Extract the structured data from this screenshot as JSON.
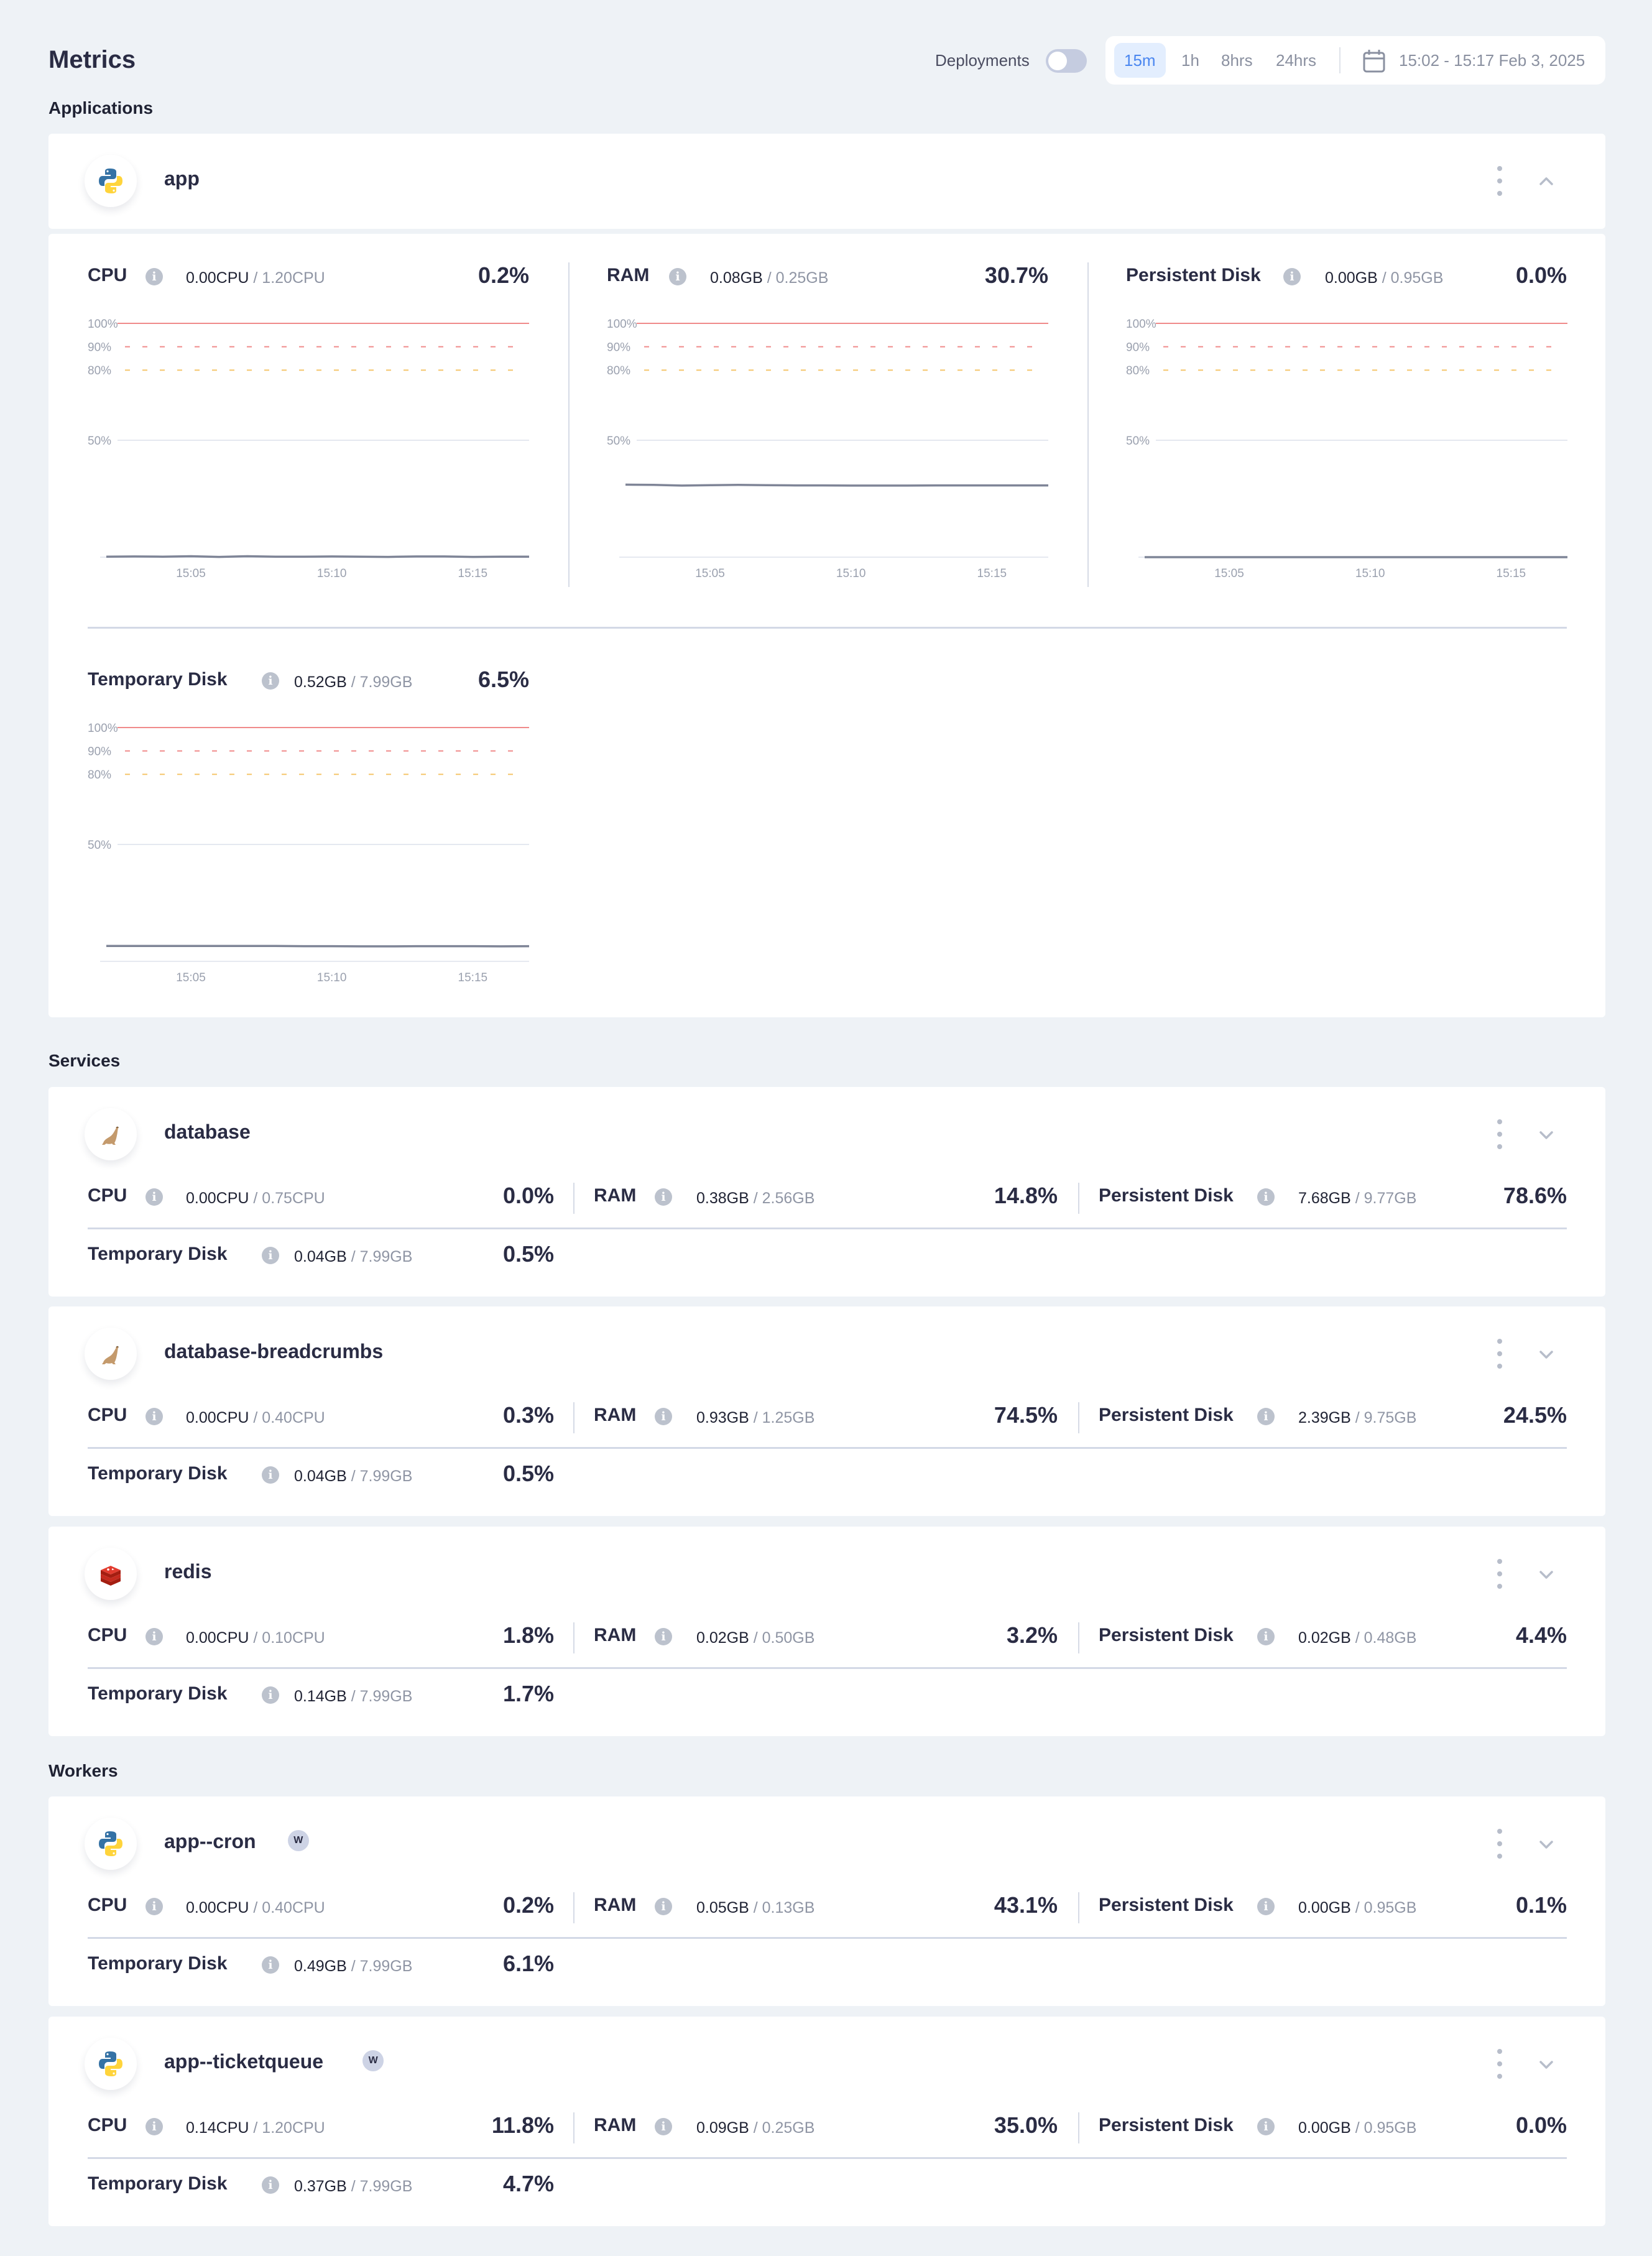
{
  "header": {
    "title": "Metrics",
    "deployments_label": "Deployments",
    "deployments_enabled": false,
    "ranges": [
      "15m",
      "1h",
      "8hrs",
      "24hrs"
    ],
    "active_range": "15m",
    "date_range": "15:02 - 15:17 Feb 3, 2025"
  },
  "sections": {
    "applications": "Applications",
    "services": "Services",
    "workers": "Workers"
  },
  "colors": {
    "critical": "#f08a8a",
    "warning": "#f5c56b",
    "series": "#7f8597",
    "accent": "#4a86f0"
  },
  "app": {
    "name": "app",
    "icon": "python-icon",
    "expanded": true,
    "charts": [
      {
        "label": "CPU",
        "used": "0.00CPU",
        "limit": "1.20CPU",
        "percent": "0.2%"
      },
      {
        "label": "RAM",
        "used": "0.08GB",
        "limit": "0.25GB",
        "percent": "30.7%"
      },
      {
        "label": "Persistent Disk",
        "used": "0.00GB",
        "limit": "0.95GB",
        "percent": "0.0%"
      },
      {
        "label": "Temporary Disk",
        "used": "0.52GB",
        "limit": "7.99GB",
        "percent": "6.5%"
      }
    ]
  },
  "chart_data": [
    {
      "type": "line",
      "title": "CPU",
      "x": [
        "15:02",
        "15:03",
        "15:04",
        "15:05",
        "15:06",
        "15:07",
        "15:08",
        "15:09",
        "15:10",
        "15:11",
        "15:12",
        "15:13",
        "15:14",
        "15:15",
        "15:16",
        "15:17"
      ],
      "xticks": [
        "15:05",
        "15:10",
        "15:15"
      ],
      "yticks": [
        "100%",
        "90%",
        "80%",
        "50%"
      ],
      "ylim": [
        0,
        100
      ],
      "thresholds": [
        {
          "value": 100,
          "style": "solid",
          "color": "critical"
        },
        {
          "value": 90,
          "style": "dashed",
          "color": "critical"
        },
        {
          "value": 80,
          "style": "dashed",
          "color": "warning"
        },
        {
          "value": 50,
          "style": "grid"
        }
      ],
      "series": [
        {
          "name": "CPU %",
          "values": [
            0.2,
            0.3,
            0.2,
            0.4,
            0.1,
            0.4,
            0.2,
            0.2,
            0.3,
            0.2,
            0.1,
            0.3,
            0.3,
            0.1,
            0.2,
            0.2
          ]
        }
      ]
    },
    {
      "type": "line",
      "title": "RAM",
      "x": [
        "15:02",
        "15:03",
        "15:04",
        "15:05",
        "15:06",
        "15:07",
        "15:08",
        "15:09",
        "15:10",
        "15:11",
        "15:12",
        "15:13",
        "15:14",
        "15:15",
        "15:16",
        "15:17"
      ],
      "xticks": [
        "15:05",
        "15:10",
        "15:15"
      ],
      "yticks": [
        "100%",
        "90%",
        "80%",
        "50%"
      ],
      "ylim": [
        0,
        100
      ],
      "thresholds": [
        {
          "value": 100,
          "style": "solid",
          "color": "critical"
        },
        {
          "value": 90,
          "style": "dashed",
          "color": "critical"
        },
        {
          "value": 80,
          "style": "dashed",
          "color": "warning"
        },
        {
          "value": 50,
          "style": "grid"
        }
      ],
      "series": [
        {
          "name": "RAM %",
          "values": [
            31.0,
            30.9,
            30.6,
            30.8,
            30.9,
            30.8,
            30.7,
            30.7,
            30.6,
            30.6,
            30.6,
            30.7,
            30.7,
            30.7,
            30.7,
            30.7
          ]
        }
      ]
    },
    {
      "type": "line",
      "title": "Persistent Disk",
      "x": [
        "15:02",
        "15:03",
        "15:04",
        "15:05",
        "15:06",
        "15:07",
        "15:08",
        "15:09",
        "15:10",
        "15:11",
        "15:12",
        "15:13",
        "15:14",
        "15:15",
        "15:16",
        "15:17"
      ],
      "xticks": [
        "15:05",
        "15:10",
        "15:15"
      ],
      "yticks": [
        "100%",
        "90%",
        "80%",
        "50%"
      ],
      "ylim": [
        0,
        100
      ],
      "thresholds": [
        {
          "value": 100,
          "style": "solid",
          "color": "critical"
        },
        {
          "value": 90,
          "style": "dashed",
          "color": "critical"
        },
        {
          "value": 80,
          "style": "dashed",
          "color": "warning"
        },
        {
          "value": 50,
          "style": "grid"
        }
      ],
      "series": [
        {
          "name": "Persistent Disk %",
          "values": [
            0.0,
            0.0,
            0.0,
            0.0,
            0.0,
            0.0,
            0.0,
            0.0,
            0.0,
            0.0,
            0.0,
            0.0,
            0.0,
            0.0,
            0.0,
            0.0
          ]
        }
      ]
    },
    {
      "type": "line",
      "title": "Temporary Disk",
      "x": [
        "15:02",
        "15:03",
        "15:04",
        "15:05",
        "15:06",
        "15:07",
        "15:08",
        "15:09",
        "15:10",
        "15:11",
        "15:12",
        "15:13",
        "15:14",
        "15:15",
        "15:16",
        "15:17"
      ],
      "xticks": [
        "15:05",
        "15:10",
        "15:15"
      ],
      "yticks": [
        "100%",
        "90%",
        "80%",
        "50%"
      ],
      "ylim": [
        0,
        100
      ],
      "thresholds": [
        {
          "value": 100,
          "style": "solid",
          "color": "critical"
        },
        {
          "value": 90,
          "style": "dashed",
          "color": "critical"
        },
        {
          "value": 80,
          "style": "dashed",
          "color": "warning"
        },
        {
          "value": 50,
          "style": "grid"
        }
      ],
      "series": [
        {
          "name": "Temporary Disk %",
          "values": [
            6.6,
            6.6,
            6.6,
            6.6,
            6.6,
            6.6,
            6.6,
            6.5,
            6.5,
            6.4,
            6.4,
            6.5,
            6.5,
            6.5,
            6.4,
            6.5
          ]
        }
      ]
    }
  ],
  "services": [
    {
      "name": "database",
      "icon": "mariadb-seal-icon",
      "badge": null,
      "metrics": [
        {
          "label": "CPU",
          "used": "0.00CPU",
          "limit": "0.75CPU",
          "percent": "0.0%"
        },
        {
          "label": "RAM",
          "used": "0.38GB",
          "limit": "2.56GB",
          "percent": "14.8%"
        },
        {
          "label": "Persistent Disk",
          "used": "7.68GB",
          "limit": "9.77GB",
          "percent": "78.6%"
        },
        {
          "label": "Temporary Disk",
          "used": "0.04GB",
          "limit": "7.99GB",
          "percent": "0.5%"
        }
      ]
    },
    {
      "name": "database-breadcrumbs",
      "icon": "mariadb-seal-icon",
      "badge": null,
      "metrics": [
        {
          "label": "CPU",
          "used": "0.00CPU",
          "limit": "0.40CPU",
          "percent": "0.3%"
        },
        {
          "label": "RAM",
          "used": "0.93GB",
          "limit": "1.25GB",
          "percent": "74.5%"
        },
        {
          "label": "Persistent Disk",
          "used": "2.39GB",
          "limit": "9.75GB",
          "percent": "24.5%"
        },
        {
          "label": "Temporary Disk",
          "used": "0.04GB",
          "limit": "7.99GB",
          "percent": "0.5%"
        }
      ]
    },
    {
      "name": "redis",
      "icon": "redis-icon",
      "badge": null,
      "metrics": [
        {
          "label": "CPU",
          "used": "0.00CPU",
          "limit": "0.10CPU",
          "percent": "1.8%"
        },
        {
          "label": "RAM",
          "used": "0.02GB",
          "limit": "0.50GB",
          "percent": "3.2%"
        },
        {
          "label": "Persistent Disk",
          "used": "0.02GB",
          "limit": "0.48GB",
          "percent": "4.4%"
        },
        {
          "label": "Temporary Disk",
          "used": "0.14GB",
          "limit": "7.99GB",
          "percent": "1.7%"
        }
      ]
    }
  ],
  "workers": [
    {
      "name": "app--cron",
      "icon": "python-icon",
      "badge": "W",
      "metrics": [
        {
          "label": "CPU",
          "used": "0.00CPU",
          "limit": "0.40CPU",
          "percent": "0.2%"
        },
        {
          "label": "RAM",
          "used": "0.05GB",
          "limit": "0.13GB",
          "percent": "43.1%"
        },
        {
          "label": "Persistent Disk",
          "used": "0.00GB",
          "limit": "0.95GB",
          "percent": "0.1%"
        },
        {
          "label": "Temporary Disk",
          "used": "0.49GB",
          "limit": "7.99GB",
          "percent": "6.1%"
        }
      ]
    },
    {
      "name": "app--ticketqueue",
      "icon": "python-icon",
      "badge": "W",
      "metrics": [
        {
          "label": "CPU",
          "used": "0.14CPU",
          "limit": "1.20CPU",
          "percent": "11.8%"
        },
        {
          "label": "RAM",
          "used": "0.09GB",
          "limit": "0.25GB",
          "percent": "35.0%"
        },
        {
          "label": "Persistent Disk",
          "used": "0.00GB",
          "limit": "0.95GB",
          "percent": "0.0%"
        },
        {
          "label": "Temporary Disk",
          "used": "0.37GB",
          "limit": "7.99GB",
          "percent": "4.7%"
        }
      ]
    }
  ]
}
